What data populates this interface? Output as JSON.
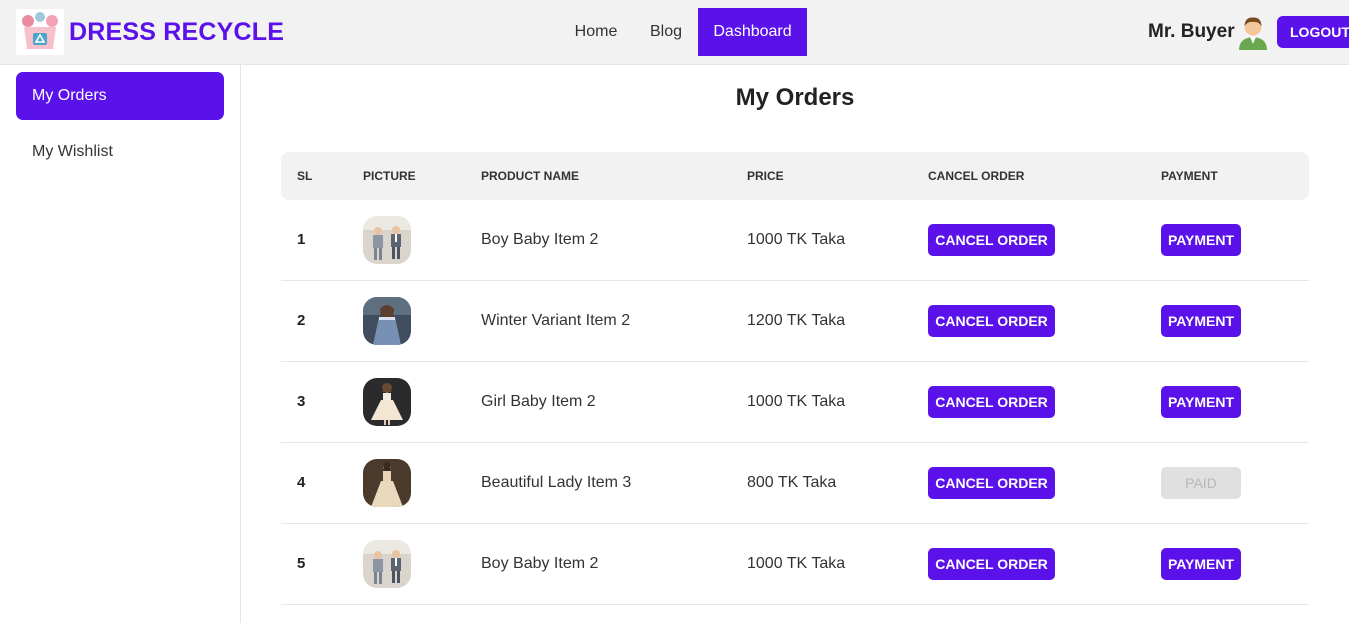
{
  "header": {
    "brand": "DRESS RECYCLE",
    "nav": {
      "home": "Home",
      "blog": "Blog",
      "dashboard": "Dashboard"
    },
    "user_name": "Mr. Buyer",
    "logout_label": "LOGOUT",
    "accent_color": "#5a11ea"
  },
  "sidebar": {
    "items": [
      {
        "label": "My Orders",
        "active": true
      },
      {
        "label": "My Wishlist",
        "active": false
      }
    ]
  },
  "main": {
    "title": "My Orders",
    "columns": [
      "SL",
      "PICTURE",
      "PRODUCT NAME",
      "PRICE",
      "CANCEL ORDER",
      "PAYMENT"
    ],
    "rows": [
      {
        "sl": "1",
        "picture": "two-boys-suits",
        "name": "Boy Baby Item 2",
        "price": "1000 TK Taka",
        "cancel": "CANCEL ORDER",
        "payment": "PAYMENT"
      },
      {
        "sl": "2",
        "picture": "girl-winter-dress",
        "name": "Winter Variant Item 2",
        "price": "1200 TK Taka",
        "cancel": "CANCEL ORDER",
        "payment": "PAYMENT"
      },
      {
        "sl": "3",
        "picture": "girl-white-gown",
        "name": "Girl Baby Item 2",
        "price": "1000 TK Taka",
        "cancel": "CANCEL ORDER",
        "payment": "PAYMENT"
      },
      {
        "sl": "4",
        "picture": "lady-beige-gown",
        "name": "Beautiful Lady Item 3",
        "price": "800 TK Taka",
        "cancel": "CANCEL ORDER",
        "payment": "PAID"
      },
      {
        "sl": "5",
        "picture": "two-boys-suits",
        "name": "Boy Baby Item 2",
        "price": "1000 TK Taka",
        "cancel": "CANCEL ORDER",
        "payment": "PAYMENT"
      }
    ]
  }
}
